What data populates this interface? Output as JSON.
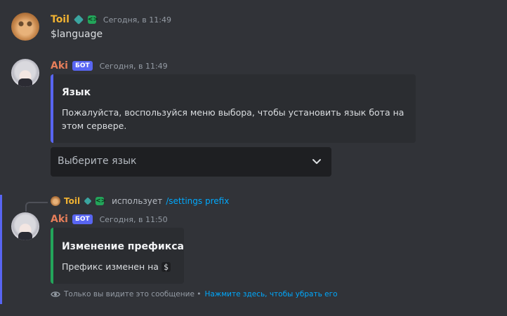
{
  "messages": [
    {
      "author": "Toil",
      "timestamp": "Сегодня, в 11:49",
      "content": "$language"
    },
    {
      "author": "Aki",
      "bot_badge": "БОТ",
      "timestamp": "Сегодня, в 11:49",
      "embed": {
        "title": "Язык",
        "description": "Пожалуйста, воспользуйся меню выбора, чтобы установить язык бота на этом сервере.",
        "accent_color": "#5865f2"
      },
      "select": {
        "placeholder": "Выберите язык"
      }
    },
    {
      "reply": {
        "author": "Toil",
        "uses_text": "использует",
        "command": "/settings prefix"
      },
      "author": "Aki",
      "bot_badge": "БОТ",
      "timestamp": "Сегодня, в 11:50",
      "embed": {
        "title": "Изменение префикса",
        "description_prefix": "Префикс изменен на",
        "new_prefix": "$",
        "accent_color": "#23a55a"
      },
      "ephemeral": {
        "note": "Только вы видите это сообщение •",
        "dismiss": "Нажмите здесь, чтобы убрать его"
      }
    }
  ],
  "icons": [
    "verified-diamond-icon",
    "code-badge-icon",
    "chevron-down-icon",
    "eye-icon"
  ],
  "colors": {
    "background": "#313338",
    "toil_name": "#f0b232",
    "aki_name": "#e67e5a",
    "link": "#00a8fc"
  }
}
